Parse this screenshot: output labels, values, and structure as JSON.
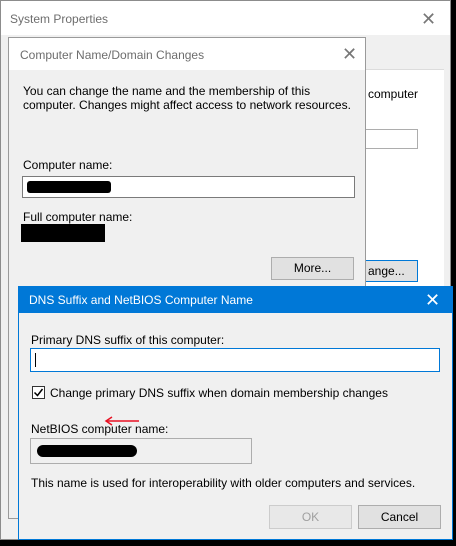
{
  "system_properties": {
    "title": "System Properties",
    "partial_text": "computer",
    "partial_button": "ange..."
  },
  "computer_name_dialog": {
    "title": "Computer Name/Domain Changes",
    "description": "You can change the name and the membership of this computer. Changes might affect access to network resources.",
    "computer_name_label": "Computer name:",
    "full_computer_name_label": "Full computer name:",
    "more_button": "More..."
  },
  "dns_dialog": {
    "title": "DNS Suffix and NetBIOS Computer Name",
    "primary_dns_label": "Primary DNS suffix of this computer:",
    "primary_dns_value": "",
    "change_checkbox_label": "Change primary DNS suffix when domain membership changes",
    "change_checkbox_checked": true,
    "netbios_label": "NetBIOS computer name:",
    "note": "This name is used for interoperability with older computers and services.",
    "ok_button": "OK",
    "cancel_button": "Cancel"
  },
  "colors": {
    "accent": "#0078d7",
    "annotation_arrow": "#e81123"
  }
}
